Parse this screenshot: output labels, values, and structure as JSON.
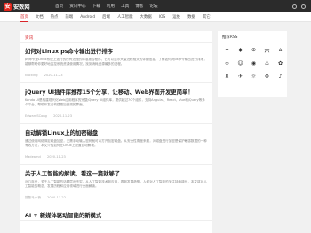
{
  "header": {
    "logo_mark": "安",
    "logo_text": "安数网",
    "nav": [
      "首页",
      "资讯中心",
      "下载",
      "利用",
      "工具",
      "博客",
      "论坛"
    ]
  },
  "subnav": {
    "items": [
      "首页",
      "文档",
      "热点",
      "前端",
      "Android",
      "后端",
      "人工智能",
      "大数据",
      "IOS",
      "运维",
      "数据",
      "其它"
    ],
    "active_index": 0
  },
  "main": {
    "section_title": "资讯",
    "articles": [
      {
        "title": "如何对Linux ps命令输出进行排序",
        "summary": "ps命令是Linux系统上运行的所有进程的标准报告程序，它可以显示大量进程相关的详细信息，了解如何对ps命令输出进行排序，能够帮助你更好地监控系统资源使用情况，找到消耗资源最多的进程。",
        "author": "Nacking",
        "date": "2020-11-23"
      },
      {
        "title": "jQuery UI插件库推荐15个分享，让移动、Web界面开发更简单！",
        "summary": "Kendo UI是构建现代化Web应用程序的完整jQuery UI组件库，提供超过70个组件，支持Angular、React、Vue和jQuery等多个平台，帮助开发者构建更加美观的界面。",
        "author": "EdwardSCong",
        "date": "2020-11-23"
      },
      {
        "title": "自动解锁Linux上的加密磁盘",
        "summary": "通过使用网络绑定磁盘加密，无需手动输入密码就可以打开加密磁盘。从安全性角度来看，对磁盘进行加密是保护敏感数据的一种有效方法，本文介绍如何在Linux上配置自动解锁。",
        "author": "Madeamd",
        "date": "2020-11-23"
      },
      {
        "title": "关于人工智能的解读，看这一篇就够了",
        "summary": "近几年来，关于人工智能的话题层出不穷，从人工智能技术到应用，再到发展趋势，人们对人工智能的关注持续增长，本文将对人工智能的概念、发展历程和应用领域进行全面解读。",
        "author": "搜数马小桥",
        "date": "2020-11-22"
      },
      {
        "title": "AI + 新媒体驱动智能的新模式",
        "summary": "",
        "author": "",
        "date": ""
      }
    ]
  },
  "sidebar": {
    "title": "推荐RSS",
    "tiles": [
      "✦",
      "◆",
      "⊕",
      "六",
      "⌂",
      "∞",
      "☺",
      "◉",
      "⚓",
      "✿",
      "♜",
      "✈",
      "☼",
      "⚙",
      "♪"
    ]
  }
}
